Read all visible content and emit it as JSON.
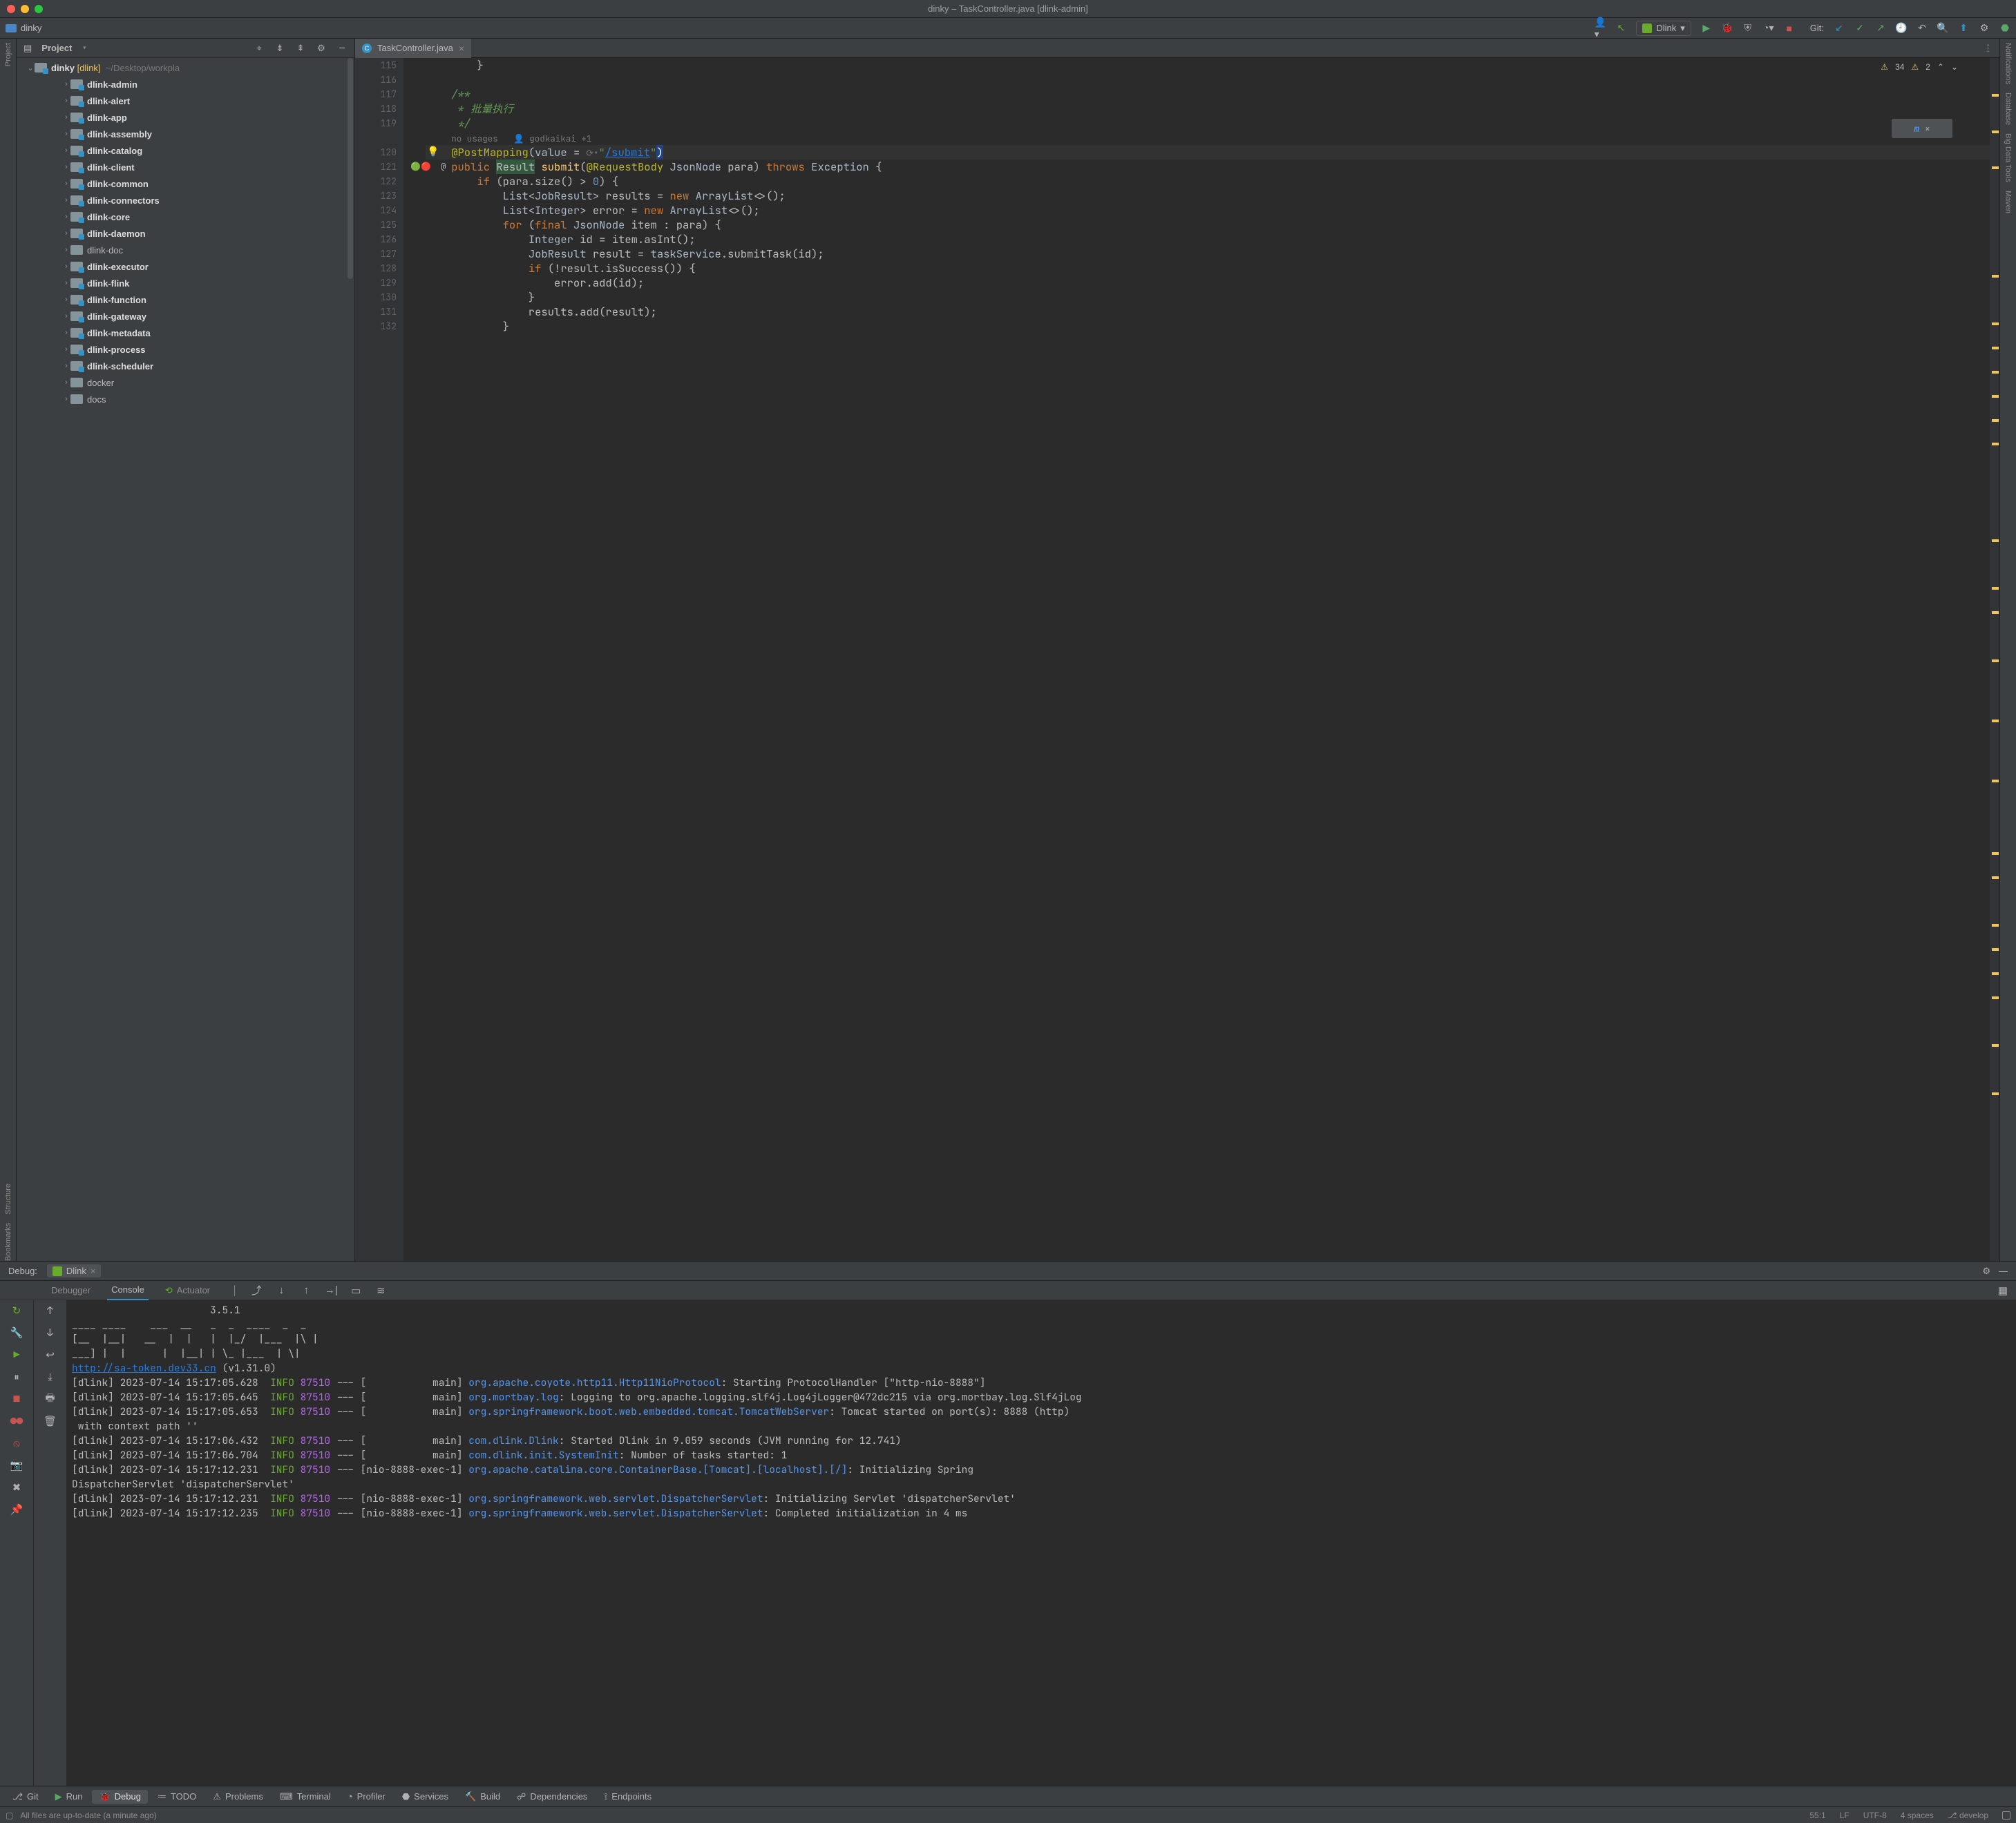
{
  "title": "dinky – TaskController.java [dlink-admin]",
  "breadcrumb": "dinky",
  "runconfig_label": "Dlink",
  "git_label": "Git:",
  "inspection": {
    "errors_label": "34",
    "warnings_label": "2"
  },
  "project_panel": {
    "title": "Project",
    "root_label": "dinky",
    "root_brak": "[dlink]",
    "root_path": "~/Desktop/workpla",
    "items": [
      "dlink-admin",
      "dlink-alert",
      "dlink-app",
      "dlink-assembly",
      "dlink-catalog",
      "dlink-client",
      "dlink-common",
      "dlink-connectors",
      "dlink-core",
      "dlink-daemon",
      "dlink-doc",
      "dlink-executor",
      "dlink-flink",
      "dlink-function",
      "dlink-gateway",
      "dlink-metadata",
      "dlink-process",
      "dlink-scheduler",
      "docker",
      "docs"
    ],
    "plain_items": [
      "dlink-doc",
      "docker",
      "docs"
    ]
  },
  "tab": {
    "label": "TaskController.java"
  },
  "editor": {
    "usage_hint_usages": "no usages",
    "usage_hint_author": "godkaikai +1",
    "code_lines": [
      {
        "n": 115,
        "html": "        }"
      },
      {
        "n": 116,
        "html": ""
      },
      {
        "n": 117,
        "html": "    <span class='cmt'>/**</span>"
      },
      {
        "n": 118,
        "html": "<span class='cmt'>     * 批量执行</span>"
      },
      {
        "n": 119,
        "html": "<span class='cmt'>     */</span>"
      },
      {
        "n": null,
        "html": "    <span class='inlay'>no usages   👤 godkaikai +1</span>"
      },
      {
        "n": 120,
        "html": "    <span class='ann'>@PostMapping</span>(<span class='par'>value</span> = <span class='inlay'>⟳▾</span><span class='str'>\"</span><span class='url'>/submit</span><span class='str'>\"</span><span class='sel'>)</span>",
        "cls": "caret-line",
        "bulb": true
      },
      {
        "n": 121,
        "html": "    <span class='kw'>public</span> <span class='highlight-word'>Result</span> <span class='fn'>submit</span>(<span class='ann'>@RequestBody</span> <span class='cls'>JsonNode</span> para) <span class='kw'>throws</span> <span class='cls'>Exception</span> {",
        "gutIcon": "🟢🔴  @"
      },
      {
        "n": 122,
        "html": "        <span class='kw'>if</span> (para.size() &gt; <span class='num'>0</span>) {"
      },
      {
        "n": 123,
        "html": "            <span class='cls'>List</span>&lt;<span class='cls'>JobResult</span>&gt; results = <span class='kw'>new</span> <span class='cls'>ArrayList</span>&lt;&gt;();"
      },
      {
        "n": 124,
        "html": "            <span class='cls'>List</span>&lt;<span class='cls'>Integer</span>&gt; error = <span class='kw'>new</span> <span class='cls'>ArrayList</span>&lt;&gt;();"
      },
      {
        "n": 125,
        "html": "            <span class='kw'>for</span> (<span class='kw'>final</span> <span class='cls'>JsonNode</span> item : para) {"
      },
      {
        "n": 126,
        "html": "                <span class='cls'>Integer</span> id = item.asInt();"
      },
      {
        "n": 127,
        "html": "                <span class='cls'>JobResult</span> result = <span class='par'>taskService</span>.submitTask(id);"
      },
      {
        "n": 128,
        "html": "                <span class='kw'>if</span> (!result.isSuccess()) {"
      },
      {
        "n": 129,
        "html": "                    error.add(id);"
      },
      {
        "n": 130,
        "html": "                }"
      },
      {
        "n": 131,
        "html": "                results.add(result);"
      },
      {
        "n": 132,
        "html": "            }"
      }
    ]
  },
  "debug": {
    "label": "Debug:",
    "session": "Dlink",
    "tabs": {
      "debugger": "Debugger",
      "console": "Console",
      "actuator": "Actuator"
    },
    "console_lines": [
      "                       3.5.1",
      "____ ____    ___  __   _  _  ____  _  _ ",
      "[__  |__|   __  |  |   |  |_/  |___  |\\ | ",
      "___] |  |      |  |__| | \\_ |___  | \\|",
      "<a>http://sa-token.dev33.cn</a> (v1.31.0)",
      "[dlink] 2023-07-14 15:17:05.628  <span class='info'>INFO</span> <span class='pid'>87510</span> --- [           main] <span class='logger'>org.apache.coyote.http11.Http11NioProtocol</span>: Starting ProtocolHandler [\"http-nio-8888\"]",
      "[dlink] 2023-07-14 15:17:05.645  <span class='info'>INFO</span> <span class='pid'>87510</span> --- [           main] <span class='logger'>org.mortbay.log</span>: Logging to org.apache.logging.slf4j.Log4jLogger@472dc215 via org.mortbay.log.Slf4jLog",
      "[dlink] 2023-07-14 15:17:05.653  <span class='info'>INFO</span> <span class='pid'>87510</span> --- [           main] <span class='logger'>org.springframework.boot.web.embedded.tomcat.TomcatWebServer</span>: Tomcat started on port(s): 8888 (http)\n with context path ''",
      "[dlink] 2023-07-14 15:17:06.432  <span class='info'>INFO</span> <span class='pid'>87510</span> --- [           main] <span class='logger'>com.dlink.Dlink</span>: Started Dlink in 9.059 seconds (JVM running for 12.741)",
      "[dlink] 2023-07-14 15:17:06.704  <span class='info'>INFO</span> <span class='pid'>87510</span> --- [           main] <span class='logger'>com.dlink.init.SystemInit</span>: Number of tasks started: 1",
      "[dlink] 2023-07-14 15:17:12.231  <span class='info'>INFO</span> <span class='pid'>87510</span> --- [nio-8888-exec-1] <span class='logger'>org.apache.catalina.core.ContainerBase.[Tomcat].[localhost].[/]</span>: Initializing Spring\nDispatcherServlet 'dispatcherServlet'",
      "[dlink] 2023-07-14 15:17:12.231  <span class='info'>INFO</span> <span class='pid'>87510</span> --- [nio-8888-exec-1] <span class='logger'>org.springframework.web.servlet.DispatcherServlet</span>: Initializing Servlet 'dispatcherServlet'",
      "[dlink] 2023-07-14 15:17:12.235  <span class='info'>INFO</span> <span class='pid'>87510</span> --- [nio-8888-exec-1] <span class='logger'>org.springframework.web.servlet.DispatcherServlet</span>: Completed initialization in 4 ms"
    ]
  },
  "bottom_tools": {
    "git": "Git",
    "run": "Run",
    "debug": "Debug",
    "todo": "TODO",
    "problems": "Problems",
    "terminal": "Terminal",
    "profiler": "Profiler",
    "services": "Services",
    "build": "Build",
    "dependencies": "Dependencies",
    "endpoints": "Endpoints"
  },
  "status": {
    "msg": "All files are up-to-date (a minute ago)",
    "pos": "55:1",
    "le": "LF",
    "enc": "UTF-8",
    "indent": "4 spaces",
    "branch": "develop"
  },
  "left_stripe": [
    "Project",
    "Bookmarks",
    "Structure"
  ],
  "right_stripe": [
    "Notifications",
    "Database",
    "Big Data Tools",
    "Maven"
  ]
}
